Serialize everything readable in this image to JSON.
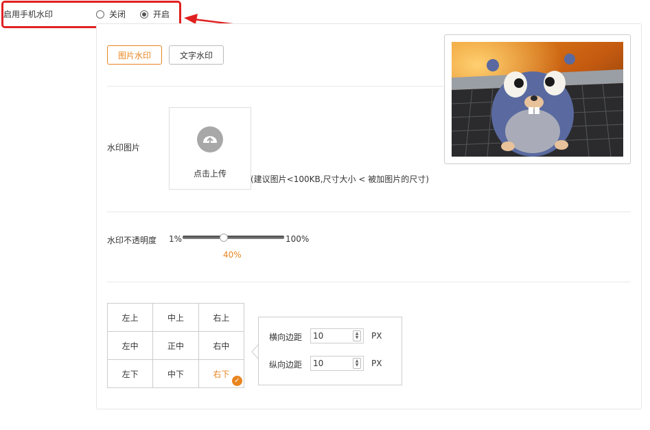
{
  "enable": {
    "label": "启用手机水印",
    "options": [
      {
        "label": "关闭",
        "checked": false
      },
      {
        "label": "开启",
        "checked": true
      }
    ]
  },
  "tabs": [
    {
      "label": "图片水印",
      "active": true
    },
    {
      "label": "文字水印",
      "active": false
    }
  ],
  "watermark_image": {
    "label": "水印图片",
    "upload_label": "点击上传",
    "hint": "(建议图片<100KB,尺寸大小 < 被加图片的尺寸)"
  },
  "opacity": {
    "label": "水印不透明度",
    "min": "1%",
    "max": "100%",
    "value_label": "40%",
    "value": 0.4
  },
  "position": {
    "cells": [
      [
        "左上",
        "中上",
        "右上"
      ],
      [
        "左中",
        "正中",
        "右中"
      ],
      [
        "左下",
        "中下",
        "右下"
      ]
    ],
    "selected": "右下"
  },
  "margins": {
    "horizontal": {
      "label": "横向边距",
      "value": "10",
      "unit": "PX"
    },
    "vertical": {
      "label": "纵向边距",
      "value": "10",
      "unit": "PX"
    }
  },
  "colors": {
    "accent": "#e8851f",
    "highlight": "#e02020"
  }
}
